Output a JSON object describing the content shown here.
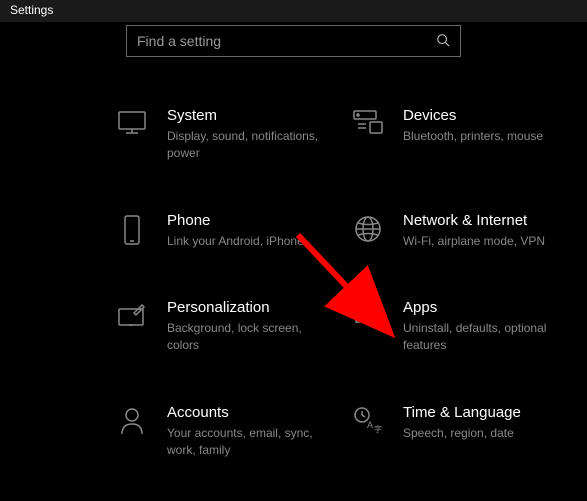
{
  "window": {
    "title": "Settings"
  },
  "search": {
    "placeholder": "Find a setting"
  },
  "tiles": {
    "system": {
      "title": "System",
      "desc": "Display, sound, notifications, power"
    },
    "devices": {
      "title": "Devices",
      "desc": "Bluetooth, printers, mouse"
    },
    "phone": {
      "title": "Phone",
      "desc": "Link your Android, iPhone"
    },
    "network": {
      "title": "Network & Internet",
      "desc": "Wi-Fi, airplane mode, VPN"
    },
    "personalization": {
      "title": "Personalization",
      "desc": "Background, lock screen, colors"
    },
    "apps": {
      "title": "Apps",
      "desc": "Uninstall, defaults, optional features"
    },
    "accounts": {
      "title": "Accounts",
      "desc": "Your accounts, email, sync, work, family"
    },
    "time": {
      "title": "Time & Language",
      "desc": "Speech, region, date"
    }
  }
}
